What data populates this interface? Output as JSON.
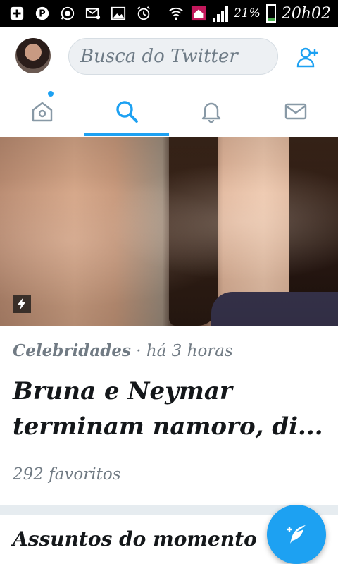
{
  "status_bar": {
    "battery_percent": "21%",
    "time": "20h02",
    "battery_level": 0.21,
    "icons": [
      "plus-box-icon",
      "pinterest-icon",
      "whatsapp-icon",
      "email-icon",
      "image-icon",
      "alarm-icon",
      "wifi-icon",
      "home-icon",
      "signal-icon",
      "battery-icon"
    ]
  },
  "header": {
    "search_placeholder": "Busca do Twitter"
  },
  "tabs": [
    {
      "name": "home",
      "icon": "home-icon",
      "has_notification": true
    },
    {
      "name": "search",
      "icon": "search-icon",
      "active": true
    },
    {
      "name": "notifications",
      "icon": "bell-icon"
    },
    {
      "name": "messages",
      "icon": "mail-icon"
    }
  ],
  "moment": {
    "category": "Celebridades",
    "separator": "·",
    "time_ago": "há 3 horas",
    "headline": "Bruna e Neymar terminam namoro, di...",
    "favorites": "292 favoritos"
  },
  "trending": {
    "title": "Assuntos do momento"
  },
  "colors": {
    "accent": "#1da1f2",
    "text_primary": "#14171a",
    "text_secondary": "#717b84"
  }
}
